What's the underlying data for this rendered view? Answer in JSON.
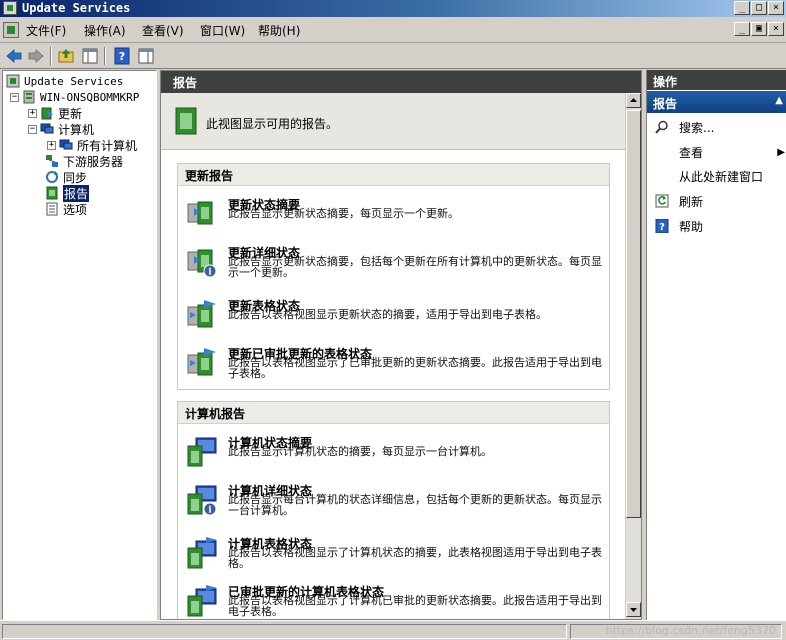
{
  "window": {
    "title": "Update Services",
    "min_glyph": "_",
    "max_glyph": "□",
    "close_glyph": "×",
    "restore_glyph": "▣"
  },
  "menu": {
    "items": [
      "文件(F)",
      "操作(A)",
      "查看(V)",
      "窗口(W)",
      "帮助(H)"
    ]
  },
  "toolbar": {
    "buttons": [
      "back-icon",
      "forward-icon",
      "up-folder-icon",
      "show-hide-tree-icon",
      "help-icon",
      "show-hide-action-pane-icon"
    ]
  },
  "tree": {
    "root": "Update Services",
    "server": "WIN-ONSQBOMMKRP",
    "updates": "更新",
    "computers": "计算机",
    "all_computers": "所有计算机",
    "downstream": "下游服务器",
    "sync": "同步",
    "reports": "报告",
    "options": "选项",
    "expand_glyph": "+",
    "collapse_glyph": "−"
  },
  "center": {
    "header": "报告",
    "intro": "此视图显示可用的报告。",
    "sections": [
      {
        "title": "更新报告",
        "items": [
          {
            "title": "更新状态摘要",
            "desc": "此报告显示更新状态摘要，每页显示一个更新。"
          },
          {
            "title": "更新详细状态",
            "desc": "此报告显示更新状态摘要，包括每个更新在所有计算机中的更新状态。每页显示一个更新。"
          },
          {
            "title": "更新表格状态",
            "desc": "此报告以表格视图显示更新状态的摘要，适用于导出到电子表格。"
          },
          {
            "title": "更新已审批更新的表格状态",
            "desc": "此报告以表格视图显示了已审批更新的更新状态摘要。此报告适用于导出到电子表格。"
          }
        ]
      },
      {
        "title": "计算机报告",
        "items": [
          {
            "title": "计算机状态摘要",
            "desc": "此报告显示计算机状态的摘要，每页显示一台计算机。"
          },
          {
            "title": "计算机详细状态",
            "desc": "此报告显示每台计算机的状态详细信息，包括每个更新的更新状态。每页显示一台计算机。"
          },
          {
            "title": "计算机表格状态",
            "desc": "此报告以表格视图显示了计算机状态的摘要，此表格视图适用于导出到电子表格。"
          },
          {
            "title": "已审批更新的计算机表格状态",
            "desc": "此报告以表格视图显示了计算机已审批的更新状态摘要。此报告适用于导出到电子表格。"
          }
        ]
      }
    ]
  },
  "actions": {
    "header": "操作",
    "subheader": "报告",
    "collapse_glyph": "▲",
    "submenu_glyph": "▶",
    "items": [
      {
        "label": "搜索...",
        "icon": "search-icon"
      },
      {
        "label": "查看",
        "icon": "none"
      },
      {
        "label": "从此处新建窗口",
        "icon": "none"
      },
      {
        "label": "刷新",
        "icon": "refresh-icon"
      },
      {
        "label": "帮助",
        "icon": "help-icon"
      }
    ]
  },
  "status": {
    "watermark": "https://blog.csdn.net/feng5370"
  }
}
